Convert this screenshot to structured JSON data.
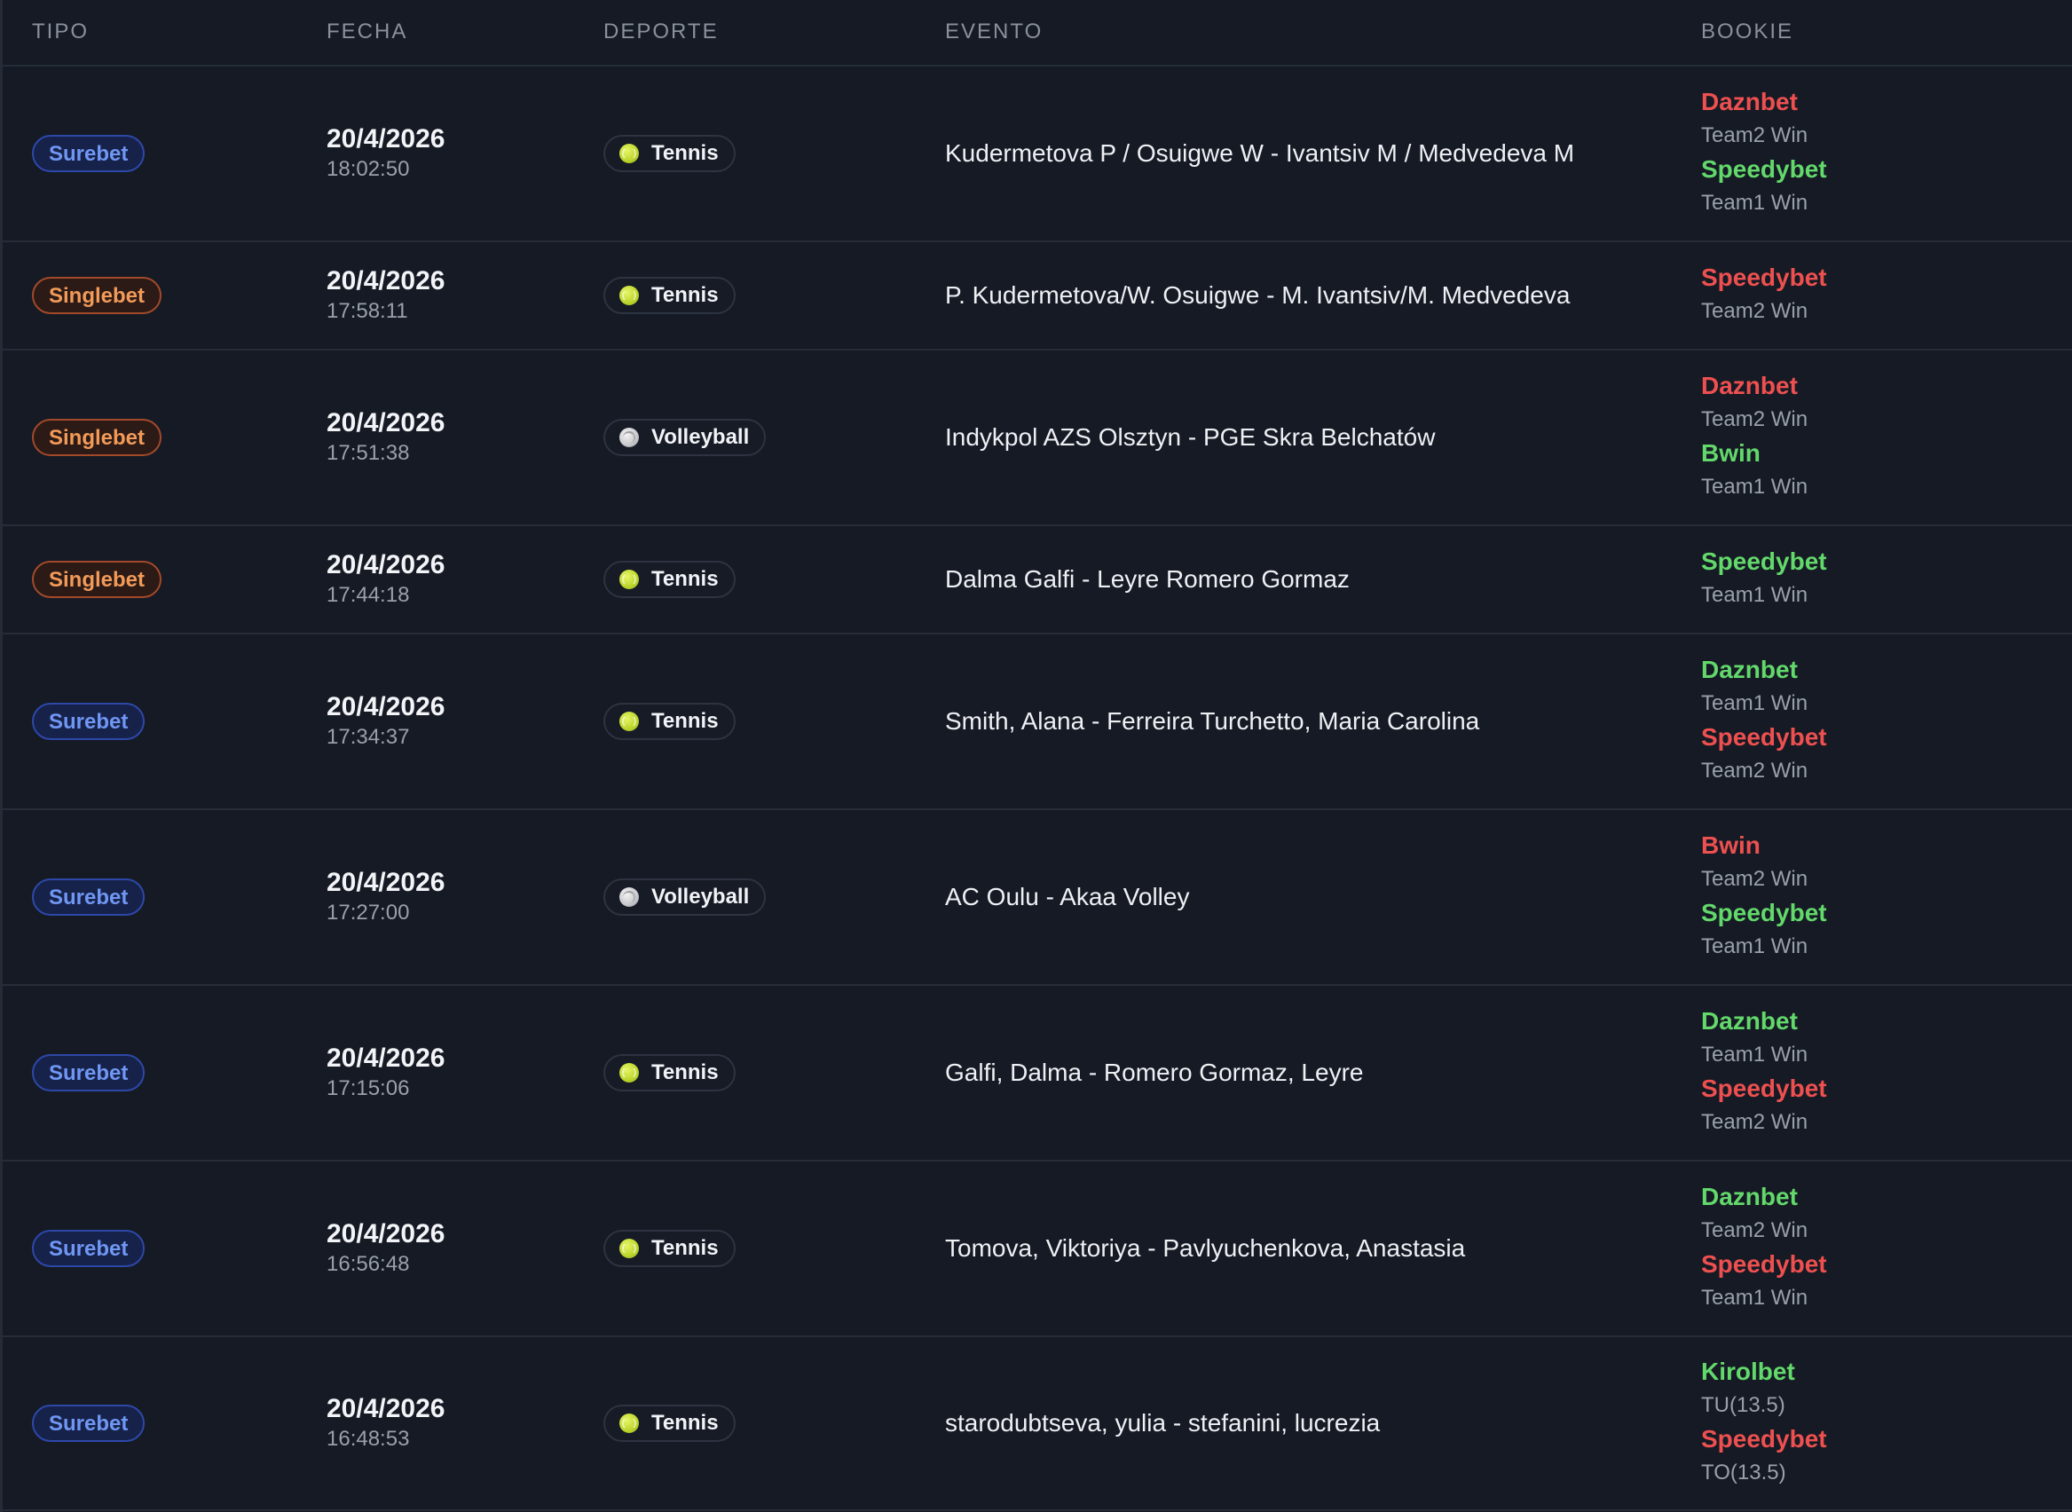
{
  "headers": {
    "tipo": "TIPO",
    "fecha": "FECHA",
    "deporte": "DEPORTE",
    "evento": "EVENTO",
    "bookie": "BOOKIE"
  },
  "colors": {
    "surebet": "#6f97f3",
    "singlebet": "#f29a58",
    "bookie_red": "#ee5050",
    "bookie_green": "#63d86b"
  },
  "rows": [
    {
      "tipo": "Surebet",
      "date": "20/4/2026",
      "time": "18:02:50",
      "sport": "Tennis",
      "sport_icon": "tennis-ball-icon",
      "event": "Kudermetova P / Osuigwe W - Ivantsiv M / Medvedeva M",
      "bookies": [
        {
          "name": "Daznbet",
          "color": "red",
          "selection": "Team2 Win"
        },
        {
          "name": "Speedybet",
          "color": "green",
          "selection": "Team1 Win"
        }
      ]
    },
    {
      "tipo": "Singlebet",
      "date": "20/4/2026",
      "time": "17:58:11",
      "sport": "Tennis",
      "sport_icon": "tennis-ball-icon",
      "event": "P. Kudermetova/W. Osuigwe - M. Ivantsiv/M. Medvedeva",
      "bookies": [
        {
          "name": "Speedybet",
          "color": "red",
          "selection": "Team2 Win"
        }
      ]
    },
    {
      "tipo": "Singlebet",
      "date": "20/4/2026",
      "time": "17:51:38",
      "sport": "Volleyball",
      "sport_icon": "volleyball-icon",
      "event": "Indykpol AZS Olsztyn - PGE Skra Belchatów",
      "bookies": [
        {
          "name": "Daznbet",
          "color": "red",
          "selection": "Team2 Win"
        },
        {
          "name": "Bwin",
          "color": "green",
          "selection": "Team1 Win"
        }
      ]
    },
    {
      "tipo": "Singlebet",
      "date": "20/4/2026",
      "time": "17:44:18",
      "sport": "Tennis",
      "sport_icon": "tennis-ball-icon",
      "event": "Dalma Galfi - Leyre Romero Gormaz",
      "bookies": [
        {
          "name": "Speedybet",
          "color": "green",
          "selection": "Team1 Win"
        }
      ]
    },
    {
      "tipo": "Surebet",
      "date": "20/4/2026",
      "time": "17:34:37",
      "sport": "Tennis",
      "sport_icon": "tennis-ball-icon",
      "event": "Smith, Alana - Ferreira Turchetto, Maria Carolina",
      "bookies": [
        {
          "name": "Daznbet",
          "color": "green",
          "selection": "Team1 Win"
        },
        {
          "name": "Speedybet",
          "color": "red",
          "selection": "Team2 Win"
        }
      ]
    },
    {
      "tipo": "Surebet",
      "date": "20/4/2026",
      "time": "17:27:00",
      "sport": "Volleyball",
      "sport_icon": "volleyball-icon",
      "event": "AC Oulu - Akaa Volley",
      "bookies": [
        {
          "name": "Bwin",
          "color": "red",
          "selection": "Team2 Win"
        },
        {
          "name": "Speedybet",
          "color": "green",
          "selection": "Team1 Win"
        }
      ]
    },
    {
      "tipo": "Surebet",
      "date": "20/4/2026",
      "time": "17:15:06",
      "sport": "Tennis",
      "sport_icon": "tennis-ball-icon",
      "event": "Galfi, Dalma - Romero Gormaz, Leyre",
      "bookies": [
        {
          "name": "Daznbet",
          "color": "green",
          "selection": "Team1 Win"
        },
        {
          "name": "Speedybet",
          "color": "red",
          "selection": "Team2 Win"
        }
      ]
    },
    {
      "tipo": "Surebet",
      "date": "20/4/2026",
      "time": "16:56:48",
      "sport": "Tennis",
      "sport_icon": "tennis-ball-icon",
      "event": "Tomova, Viktoriya - Pavlyuchenkova, Anastasia",
      "bookies": [
        {
          "name": "Daznbet",
          "color": "green",
          "selection": "Team2 Win"
        },
        {
          "name": "Speedybet",
          "color": "red",
          "selection": "Team1 Win"
        }
      ]
    },
    {
      "tipo": "Surebet",
      "date": "20/4/2026",
      "time": "16:48:53",
      "sport": "Tennis",
      "sport_icon": "tennis-ball-icon",
      "event": "starodubtseva, yulia - stefanini, lucrezia",
      "bookies": [
        {
          "name": "Kirolbet",
          "color": "green",
          "selection": "TU(13.5)"
        },
        {
          "name": "Speedybet",
          "color": "red",
          "selection": "TO(13.5)"
        }
      ]
    }
  ]
}
